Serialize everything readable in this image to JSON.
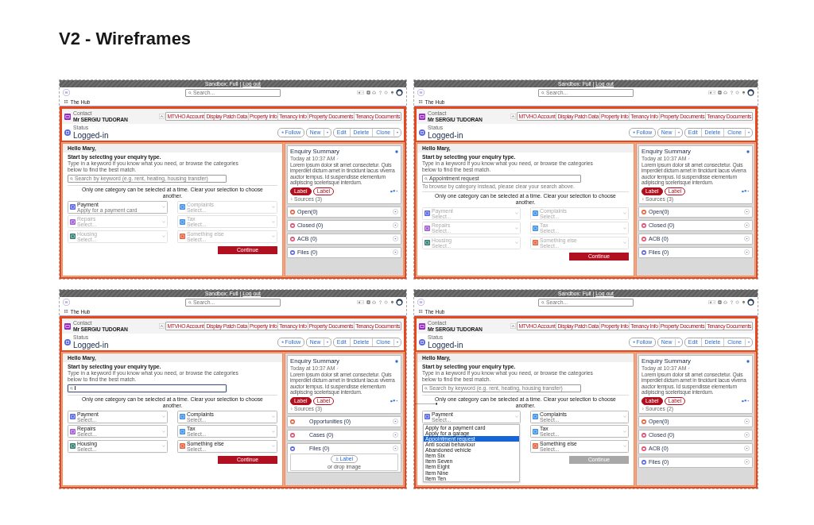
{
  "title": "V2 - Wireframes",
  "frames": [
    {
      "env": "Sandbox: Full |",
      "logout": "Log out",
      "search_placeholder": "Search...",
      "app": "The Hub",
      "record_type": "Contact",
      "record_name": "Mr SERGIU TUDORAN",
      "tabs": [
        "MTVHO Account",
        "Display Patch Data",
        "Property Info",
        "Tenancy Info",
        "Property Documents",
        "Tenancy Documents"
      ],
      "status_label": "Status",
      "status_value": "Logged-in",
      "actions": {
        "follow": "Follow",
        "new": "New",
        "edit": "Edit",
        "delete": "Delete",
        "clone": "Clone"
      },
      "greeting": "Hello Mary,",
      "heading": "Start by selecting your enquiry type.",
      "intro": "Type in a keyword if you know what you need, or browse the categories below to find the best match.",
      "search": {
        "placeholder": "Search by keyword (e.g. rent, heating, housing transfer)",
        "focused": false
      },
      "notice": "Only one category can be selected at a time. Clear your selection to choose another.",
      "annotation_marker": false,
      "category_columns": [
        [
          {
            "name": "Payment",
            "subtitle": "Apply for a payment card",
            "color": "#5867e8",
            "disabled": false
          },
          {
            "name": "Repairs",
            "subtitle": "Select...",
            "color": "#a15ad8",
            "disabled": true
          },
          {
            "name": "Housing",
            "subtitle": "Select...",
            "color": "#2e7d72",
            "disabled": true
          }
        ],
        [
          {
            "name": "Complaints",
            "subtitle": "Select...",
            "color": "#3b8eea",
            "disabled": true
          },
          {
            "name": "Tax",
            "subtitle": "Select...",
            "color": "#3b8eea",
            "disabled": true
          },
          {
            "name": "Something else",
            "subtitle": "Select...",
            "color": "#e8603c",
            "disabled": true
          }
        ]
      ],
      "continue": {
        "label": "Continue",
        "disabled": false
      },
      "summary": {
        "title": "Enquiry Summary",
        "time": "Today at 10:37 AM",
        "body": "Lorem ipsum dolor sit amet consectetur. Quis imperdiet dictum amet in tincidunt lacus viverra auctor tempus. Id suspendisse elementum adipiscing scelerisque interdum.",
        "chips": [
          "Label",
          "Label"
        ],
        "sources": "Sources (3)"
      },
      "sections": [
        {
          "label": "Open(0)",
          "color": "#e8603c"
        },
        {
          "label": "Closed (0)",
          "color": "#e44d6f"
        },
        {
          "label": "ACB (0)",
          "color": "#e44d6f"
        },
        {
          "label": "Files (0)",
          "color": "#5867e8"
        }
      ]
    },
    {
      "env": "Sandbox: Full |",
      "logout": "Log out",
      "search_placeholder": "Search...",
      "app": "The Hub",
      "record_type": "Contact",
      "record_name": "Mr SERGIU TUDORAN",
      "tabs": [
        "MTVHO Account",
        "Display Patch Data",
        "Property Info",
        "Tenancy Info",
        "Property Documents",
        "Tenancy Documents"
      ],
      "status_label": "Status",
      "status_value": "Logged-in",
      "actions": {
        "follow": "Follow",
        "new": "New",
        "edit": "Edit",
        "delete": "Delete",
        "clone": "Clone"
      },
      "greeting": "Hello Mary,",
      "heading": "Start by selecting your enquiry type.",
      "intro": "Type in a keyword if you know what you need, or browse the categories below to find the best match.",
      "search": {
        "value": "Appointment request",
        "focused": false
      },
      "search_hint": "To browse by category instead, please clear your search above.",
      "notice": "Only one category can be selected at a time. Clear your selection to choose another.",
      "annotation_marker": false,
      "category_columns": [
        [
          {
            "name": "Payment",
            "subtitle": "Select...",
            "color": "#5867e8",
            "disabled": true
          },
          {
            "name": "Repairs",
            "subtitle": "Select...",
            "color": "#a15ad8",
            "disabled": true
          },
          {
            "name": "Housing",
            "subtitle": "Select...",
            "color": "#2e7d72",
            "disabled": true
          }
        ],
        [
          {
            "name": "Complaints",
            "subtitle": "Select...",
            "color": "#3b8eea",
            "disabled": true
          },
          {
            "name": "Tax",
            "subtitle": "Select...",
            "color": "#3b8eea",
            "disabled": true
          },
          {
            "name": "Something else",
            "subtitle": "Select...",
            "color": "#e8603c",
            "disabled": true
          }
        ]
      ],
      "continue": {
        "label": "Continue",
        "disabled": false
      },
      "summary": {
        "title": "Enquiry Summary",
        "time": "Today at 10:37 AM",
        "body": "Lorem ipsum dolor sit amet consectetur. Quis imperdiet dictum amet in tincidunt lacus viverra auctor tempus. Id suspendisse elementum adipiscing scelerisque interdum.",
        "chips": [
          "Label",
          "Label"
        ],
        "sources": "Sources (3)"
      },
      "sections": [
        {
          "label": "Open(0)",
          "color": "#e8603c"
        },
        {
          "label": "Closed (0)",
          "color": "#e44d6f"
        },
        {
          "label": "ACB (0)",
          "color": "#e44d6f"
        },
        {
          "label": "Files (0)",
          "color": "#5867e8"
        }
      ]
    },
    {
      "env": "Sandbox: Full |",
      "logout": "Log out",
      "search_placeholder": "Search...",
      "app": "The Hub",
      "record_type": "Contact",
      "record_name": "Mr SERGIU TUDORAN",
      "tabs": [
        "MTVHO Account",
        "Display Patch Data",
        "Property Info",
        "Tenancy Info",
        "Property Documents",
        "Tenancy Documents"
      ],
      "status_label": "Status",
      "status_value": "Logged-in",
      "actions": {
        "follow": "Follow",
        "new": "New",
        "edit": "Edit",
        "delete": "Delete",
        "clone": "Clone"
      },
      "greeting": "Hello Mary,",
      "heading": "Start by selecting your enquiry type.",
      "intro": "Type in a keyword if you know what you need, or browse the categories below to find the best match.",
      "search": {
        "focused": true
      },
      "notice": "Only one category can be selected at a time. Clear your selection to choose another.",
      "annotation_marker": false,
      "category_columns": [
        [
          {
            "name": "Payment",
            "subtitle": "Select...",
            "color": "#5867e8",
            "disabled": false
          },
          {
            "name": "Repairs",
            "subtitle": "Select...",
            "color": "#a15ad8",
            "disabled": false
          },
          {
            "name": "Housing",
            "subtitle": "Select...",
            "color": "#2e7d72",
            "disabled": false
          }
        ],
        [
          {
            "name": "Complaints",
            "subtitle": "Select...",
            "color": "#3b8eea",
            "disabled": false
          },
          {
            "name": "Tax",
            "subtitle": "Select...",
            "color": "#3b8eea",
            "disabled": false
          },
          {
            "name": "Something else",
            "subtitle": "Select...",
            "color": "#e8603c",
            "disabled": false
          }
        ]
      ],
      "continue": {
        "label": "Continue",
        "disabled": false
      },
      "summary": {
        "title": "Enquiry Summary",
        "time": "Today at 10:37 AM",
        "body": "Lorem ipsum dolor sit amet consectetur. Quis imperdiet dictum amet in tincidunt lacus viverra auctor tempus. Id suspendisse elementum adipiscing scelerisque interdum.",
        "chips": [
          "Label",
          "Label"
        ],
        "sources": "Sources (3)"
      },
      "sections": [
        {
          "label": "Opportunities (0)",
          "color": "#e8603c"
        },
        {
          "label": "Cases (0)",
          "color": "#e44d6f"
        },
        {
          "label": "Files (0)",
          "color": "#5867e8"
        }
      ],
      "upload": {
        "button": "Label",
        "hint": "or drop image"
      }
    },
    {
      "env": "Sandbox: Full |",
      "logout": "Log out",
      "search_placeholder": "Search...",
      "app": "The Hub",
      "record_type": "Contact",
      "record_name": "Mr SERGIU TUDORAN",
      "tabs": [
        "MTVHO Account",
        "Display Patch Data",
        "Property Info",
        "Tenancy Info",
        "Property Documents",
        "Tenancy Documents"
      ],
      "status_label": "Status",
      "status_value": "Logged-in",
      "actions": {
        "follow": "Follow",
        "new": "New",
        "edit": "Edit",
        "delete": "Delete",
        "clone": "Clone"
      },
      "greeting": "Hello Mary,",
      "heading": "Start by selecting your enquiry type.",
      "intro": "Type in a keyword if you know what you need, or browse the categories below to find the best match.",
      "search": {
        "placeholder": "Search by keyword (e.g. rent, heating, housing transfer)",
        "focused": false
      },
      "notice": "Only one category can be selected at a time. Clear your selection to choose another.",
      "annotation_marker": true,
      "category_columns": [
        [
          {
            "name": "Payment",
            "subtitle": "Select...",
            "color": "#5867e8",
            "disabled": false
          }
        ],
        [
          {
            "name": "Complaints",
            "subtitle": "Select...",
            "color": "#3b8eea",
            "disabled": false
          },
          {
            "name": "Tax",
            "subtitle": "Select...",
            "color": "#3b8eea",
            "disabled": false
          },
          {
            "name": "Something else",
            "subtitle": "Select...",
            "color": "#e8603c",
            "disabled": false
          }
        ]
      ],
      "dropdown": [
        {
          "label": "Apply for a payment card",
          "selected": false
        },
        {
          "label": "Apply for a garage",
          "selected": false
        },
        {
          "label": "Appointment request",
          "selected": true
        },
        {
          "label": "Anti social behaviour",
          "selected": false
        },
        {
          "label": "Abandoned vehicle",
          "selected": false
        },
        {
          "label": "Item Six",
          "selected": false
        },
        {
          "label": "Item Seven",
          "selected": false
        },
        {
          "label": "Item Eight",
          "selected": false
        },
        {
          "label": "Item Nine",
          "selected": false
        },
        {
          "label": "Item Ten",
          "selected": false
        }
      ],
      "continue": {
        "label": "Continue",
        "disabled": true
      },
      "summary": {
        "title": "Enquiry Summary",
        "time": "Today at 10:37 AM",
        "body": "Lorem ipsum dolor sit amet consectetur. Quis imperdiet dictum amet in tincidunt lacus viverra auctor tempus. Id suspendisse elementum adipiscing scelerisque interdum.",
        "chips": [
          "Label",
          "Label"
        ],
        "sources": "Sources (2)"
      },
      "sections": [
        {
          "label": "Open(0)",
          "color": "#e8603c"
        },
        {
          "label": "Closed (0)",
          "color": "#e44d6f"
        },
        {
          "label": "ACB (0)",
          "color": "#e44d6f"
        },
        {
          "label": "Files (0)",
          "color": "#5867e8"
        }
      ]
    }
  ]
}
